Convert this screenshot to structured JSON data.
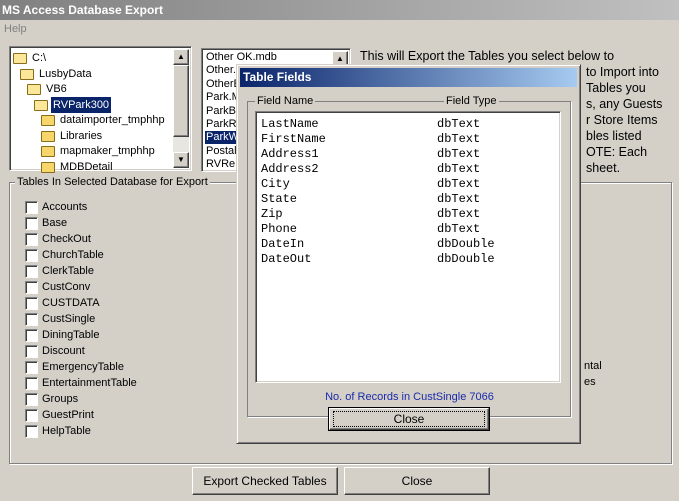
{
  "window": {
    "title": "MS Access Database Export"
  },
  "menu": {
    "help": "Help"
  },
  "directories": [
    {
      "label": "C:\\",
      "level": 0,
      "selected": false,
      "open": true
    },
    {
      "label": "LusbyData",
      "level": 1,
      "selected": false,
      "open": true
    },
    {
      "label": "VB6",
      "level": 2,
      "selected": false,
      "open": true
    },
    {
      "label": "RVPark300",
      "level": 3,
      "selected": true,
      "open": true
    },
    {
      "label": "dataimporter_tmphhp",
      "level": 4,
      "selected": false,
      "open": false
    },
    {
      "label": "Libraries",
      "level": 4,
      "selected": false,
      "open": false
    },
    {
      "label": "mapmaker_tmphhp",
      "level": 4,
      "selected": false,
      "open": false
    },
    {
      "label": "MDBDetail",
      "level": 4,
      "selected": false,
      "open": false
    }
  ],
  "files": [
    {
      "label": "Other OK.mdb",
      "selected": false
    },
    {
      "label": "Other.n",
      "selected": false
    },
    {
      "label": "OtherE",
      "selected": false
    },
    {
      "label": "Park.M",
      "selected": false
    },
    {
      "label": "ParkBl",
      "selected": false
    },
    {
      "label": "ParkR",
      "selected": false
    },
    {
      "label": "ParkW",
      "selected": true
    },
    {
      "label": "Postall",
      "selected": false
    },
    {
      "label": "RVRe",
      "selected": false
    }
  ],
  "info_lines": [
    "This will Export the Tables you select below to",
    "to Import into",
    "Tables you",
    "s, any Guests",
    "r Store Items",
    "bles listed",
    "OTE: Each",
    "sheet."
  ],
  "tables_group": {
    "label": "Tables In Selected Database for Export",
    "tables": [
      "Accounts",
      "Base",
      "CheckOut",
      "ChurchTable",
      "ClerkTable",
      "CustConv",
      "CUSTDATA",
      "CustSingle",
      "DiningTable",
      "Discount",
      "EmergencyTable",
      "EntertainmentTable",
      "Groups",
      "GuestPrint",
      "HelpTable"
    ],
    "right_fragments": [
      "ntal",
      "es"
    ]
  },
  "buttons": {
    "export": "Export Checked Tables",
    "close": "Close"
  },
  "dialog": {
    "title": "Table Fields",
    "col_name": "Field Name",
    "col_type": "Field Type",
    "fields": [
      {
        "name": "LastName",
        "type": "dbText"
      },
      {
        "name": "FirstName",
        "type": "dbText"
      },
      {
        "name": "Address1",
        "type": "dbText"
      },
      {
        "name": "Address2",
        "type": "dbText"
      },
      {
        "name": "City",
        "type": "dbText"
      },
      {
        "name": "State",
        "type": "dbText"
      },
      {
        "name": "Zip",
        "type": "dbText"
      },
      {
        "name": "Phone",
        "type": "dbText"
      },
      {
        "name": "DateIn",
        "type": "dbDouble"
      },
      {
        "name": "DateOut",
        "type": "dbDouble"
      }
    ],
    "records": "No. of Records in CustSingle  7066",
    "close": "Close"
  }
}
